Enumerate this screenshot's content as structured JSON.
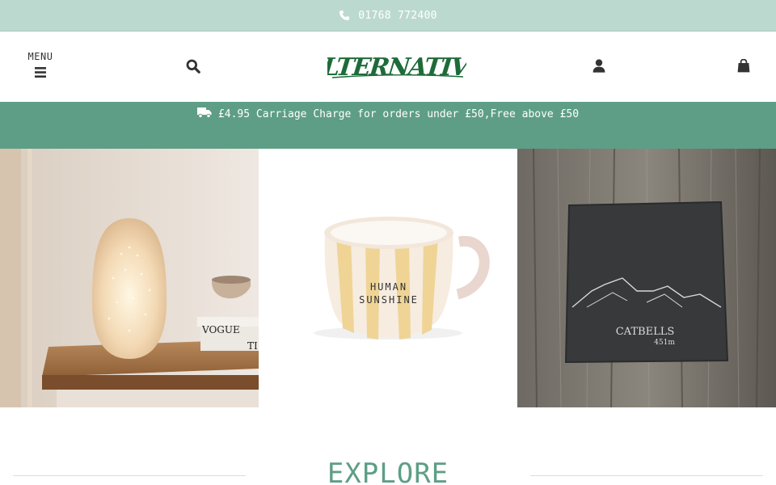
{
  "topbar": {
    "phone": "01768 772400",
    "icon": "phone-icon"
  },
  "header": {
    "menu_label": "MENU",
    "logo_text": "ALTERNATIVE",
    "icons": {
      "menu": "hamburger-icon",
      "search": "search-icon",
      "account": "user-icon",
      "cart": "shopping-bag-icon"
    }
  },
  "shipping": {
    "text": "£4.95 Carriage Charge for orders under £50,Free above £50",
    "icon": "truck-icon"
  },
  "tiles": [
    {
      "label": "lamp-product",
      "book_text": "VOGUE",
      "book_text2": "TI"
    },
    {
      "label": "mug-product",
      "mug_line1": "HUMAN",
      "mug_line2": "SUNSHINE"
    },
    {
      "label": "slate-coaster-product",
      "slate_line1": "CATBELLS",
      "slate_line2": "451m"
    }
  ],
  "explore": {
    "title": "EXPLORE"
  },
  "colors": {
    "topbar": "#bcd9d0",
    "accent": "#5e9e86",
    "logo_green": "#1e6b3a"
  }
}
